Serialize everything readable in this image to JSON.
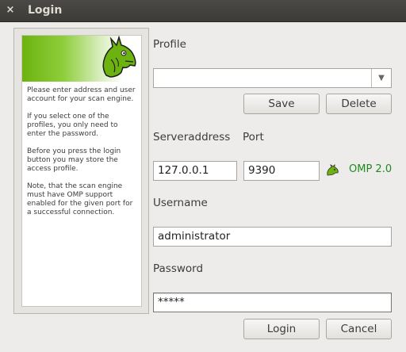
{
  "window": {
    "title": "Login",
    "close_glyph": "×"
  },
  "help": {
    "paragraphs": [
      "Please enter address and user account for your scan engine.",
      "If you select one of the profiles, you only need to enter the password.",
      "Before you press the login button you may store the access profile.",
      "Note, that the scan engine must have OMP support enabled for the given port for a successful connection."
    ]
  },
  "profile": {
    "label": "Profile",
    "value": "",
    "arrow_glyph": "▼",
    "save_label": "Save",
    "delete_label": "Delete"
  },
  "server": {
    "address_label": "Serveraddress",
    "port_label": "Port",
    "address_value": "127.0.0.1",
    "port_value": "9390",
    "protocol_status": "OMP 2.0",
    "status_color": "#1f8a1f"
  },
  "username": {
    "label": "Username",
    "value": "administrator"
  },
  "password": {
    "label": "Password",
    "value": "*****"
  },
  "actions": {
    "login_label": "Login",
    "cancel_label": "Cancel"
  },
  "colors": {
    "titlebar": "#3c3b37",
    "brand_green": "#6cb30f"
  },
  "icons": {
    "close": "close-icon",
    "logo": "greenbone-dragon-logo",
    "status": "omp-connection-icon",
    "dropdown": "chevron-down-icon"
  }
}
